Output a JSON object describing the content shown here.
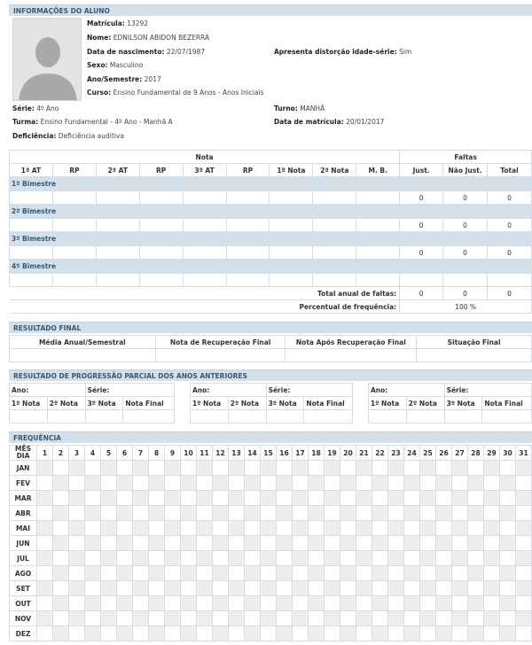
{
  "sections": {
    "info": "INFORMAÇÕES DO ALUNO",
    "final": "RESULTADO FINAL",
    "progression": "RESULTADO DE PROGRESSÃO PARCIAL DOS ANOS ANTERIORES",
    "frequency": "FREQUÊNCIA"
  },
  "student": {
    "matricula_label": "Matrícula:",
    "matricula": "13292",
    "nome_label": "Nome:",
    "nome": "EDNILSON ABIDON BEZERRA",
    "nasc_label": "Data de nascimento:",
    "nasc": "22/07/1987",
    "distorcao_label": "Apresenta distorção idade-série:",
    "distorcao": "Sim",
    "sexo_label": "Sexo:",
    "sexo": "Masculino",
    "ano_label": "Ano/Semestre:",
    "ano": "2017",
    "curso_label": "Curso:",
    "curso": "Ensino Fundamental de 9 Anos - Anos Iniciais",
    "serie_label": "Série:",
    "serie": "4º Ano",
    "turno_label": "Turno:",
    "turno": "MANHÃ",
    "turma_label": "Turma:",
    "turma": "Ensino Fundamental - 4º Ano - Manhã A",
    "data_mat_label": "Data de matrícula:",
    "data_mat": "20/01/2017",
    "defic_label": "Deficiência:",
    "defic": "Deficiência auditiva"
  },
  "grades": {
    "nota_header": "Nota",
    "faltas_header": "Faltas",
    "columns": [
      "1ª AT",
      "RP",
      "2ª AT",
      "RP",
      "3ª AT",
      "RP",
      "1ª Nota",
      "2ª Nota",
      "M. B.",
      "Just.",
      "Não Just.",
      "Total"
    ],
    "bimesters": [
      {
        "label": "1º Bimestre",
        "just": "0",
        "nao_just": "0",
        "total": "0"
      },
      {
        "label": "2º Bimestre",
        "just": "0",
        "nao_just": "0",
        "total": "0"
      },
      {
        "label": "3º Bimestre",
        "just": "0",
        "nao_just": "0",
        "total": "0"
      },
      {
        "label": "4º Bimestre",
        "just": "",
        "nao_just": "",
        "total": ""
      }
    ],
    "total_label": "Total anual de faltas:",
    "total_just": "0",
    "total_nao_just": "0",
    "total_total": "0",
    "freq_label": "Percentual de frequência:",
    "freq_value": "100 %"
  },
  "final_result": {
    "columns": [
      "Média Anual/Semestral",
      "Nota de Recuperação Final",
      "Nota Após Recuperação Final",
      "Situação Final"
    ]
  },
  "progression": {
    "ano_label": "Ano:",
    "serie_label": "Série:",
    "columns": [
      "1º Nota",
      "2º Nota",
      "3º Nota",
      "Nota Final"
    ]
  },
  "frequency": {
    "corner_top": "MÊS",
    "corner_bottom": "DIA",
    "months": [
      "JAN",
      "FEV",
      "MAR",
      "ABR",
      "MAI",
      "JUN",
      "JUL",
      "AGO",
      "SET",
      "OUT",
      "NOV",
      "DEZ"
    ],
    "days": [
      "1",
      "2",
      "3",
      "4",
      "5",
      "6",
      "7",
      "8",
      "9",
      "10",
      "11",
      "12",
      "13",
      "14",
      "15",
      "16",
      "17",
      "18",
      "19",
      "20",
      "21",
      "22",
      "23",
      "24",
      "25",
      "26",
      "27",
      "28",
      "29",
      "30",
      "31"
    ]
  }
}
